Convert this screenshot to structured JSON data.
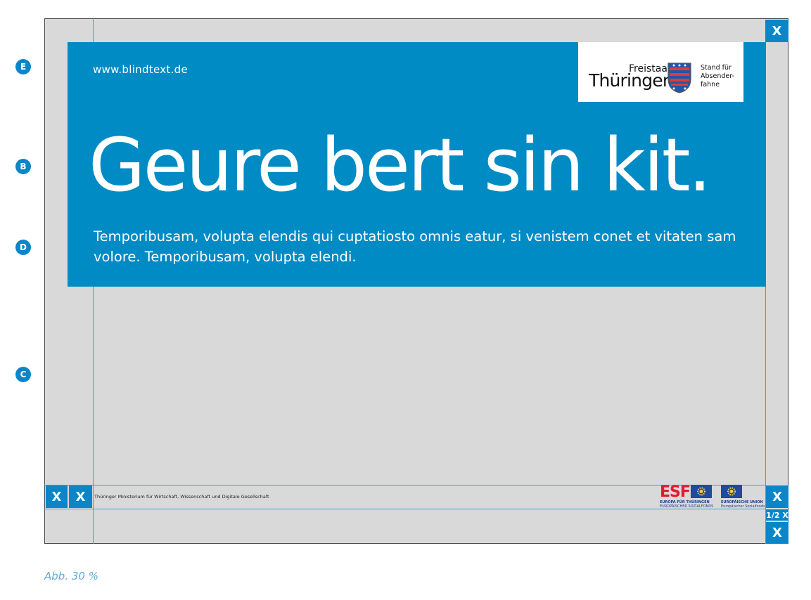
{
  "markers": [
    "E",
    "B",
    "D",
    "C"
  ],
  "poster": {
    "url": "www.blindtext.de",
    "headline": "Geure bert sin kit.",
    "body": "Temporibusam, volupta elendis qui cuptatiosto omnis eatur, si venistem conet et vitaten sam volore. Temporibusam, volupta elendi.",
    "logo": {
      "freistaat": "Freistaat",
      "thueringen": "Thüringen",
      "sender_line1": "Stand für",
      "sender_line2": "Absender-",
      "sender_line3": "fahne"
    },
    "ministry": "Thüringer Ministerium für Wirtschaft, Wissenschaft und Digitale Gesellschaft",
    "esf": {
      "word": "ESF",
      "line1": "EUROPA FÜR THÜRINGEN",
      "line2": "EUROPÄISCHER SOZIALFONDS"
    },
    "eu": {
      "line1": "EUROPÄISCHE UNION",
      "line2": "Europäischer Sozialfonds"
    }
  },
  "measure": {
    "x": "X",
    "half_x": "1/2 X"
  },
  "caption": "Abb. 30 %",
  "colors": {
    "panel_blue": "#008bc4",
    "marker_blue": "#0a86c8",
    "canvas_gray": "#d9d9d9",
    "esf_red": "#e3192e",
    "eu_blue": "#1f4aa0"
  }
}
